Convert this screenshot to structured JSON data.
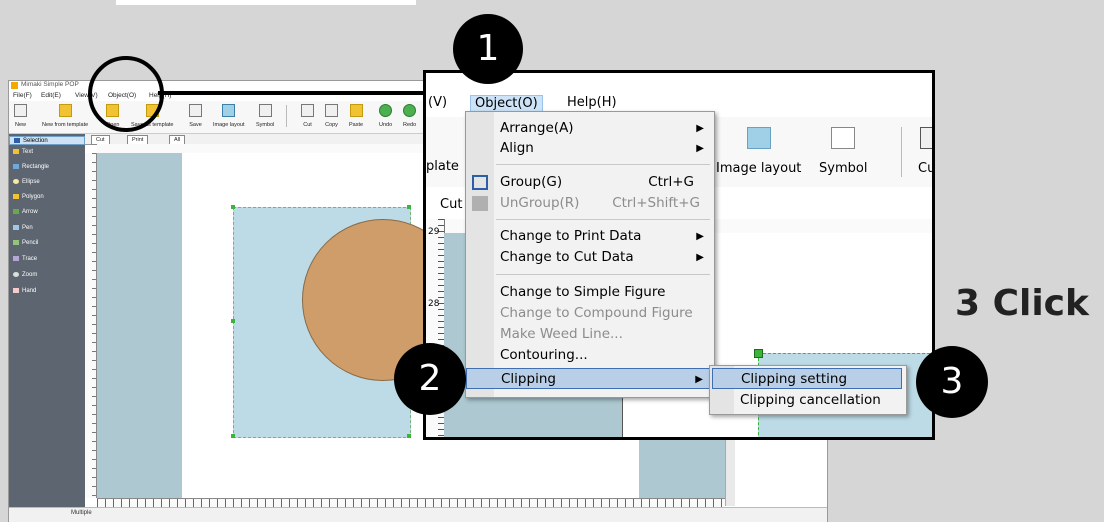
{
  "app": {
    "window_title": "Mimaki Simple POP",
    "menu": [
      "File(F)",
      "Edit(E)",
      "View(V)",
      "Object(O)",
      "Help(H)"
    ],
    "toolbar": [
      "New",
      "New from template",
      "Open",
      "Save as template",
      "Save",
      "Image layout",
      "Symbol",
      "Cut",
      "Copy",
      "Paste",
      "Undo",
      "Redo"
    ],
    "tools": [
      "Selection",
      "Text",
      "Rectangle",
      "Ellipse",
      "Polygon",
      "Arrow",
      "Pen",
      "Pencil",
      "Trace",
      "Zoom",
      "Hand"
    ],
    "tabs": [
      "Cut",
      "Print",
      "All"
    ],
    "status": "Multiple"
  },
  "zoom": {
    "menu_view": "(V)",
    "menu_object": "Object(O)",
    "menu_help": "Help(H)",
    "toolbar_template": "plate",
    "toolbar_image": "Image layout",
    "toolbar_symbol": "Symbol",
    "toolbar_cut": "Cu",
    "tab_cut": "Cut",
    "ruler_29": "29",
    "ruler_28": "28"
  },
  "object_menu": {
    "items": [
      {
        "label": "Arrange(A)",
        "shortcut": "",
        "submenu": true,
        "disabled": false
      },
      {
        "label": "Align",
        "shortcut": "",
        "submenu": true,
        "disabled": false
      },
      {
        "label": "Group(G)",
        "shortcut": "Ctrl+G",
        "submenu": false,
        "disabled": false
      },
      {
        "label": "UnGroup(R)",
        "shortcut": "Ctrl+Shift+G",
        "submenu": false,
        "disabled": true
      },
      {
        "label": "Change to Print Data",
        "shortcut": "",
        "submenu": true,
        "disabled": false
      },
      {
        "label": "Change to Cut Data",
        "shortcut": "",
        "submenu": true,
        "disabled": false
      },
      {
        "label": "Change to Simple Figure",
        "shortcut": "",
        "submenu": false,
        "disabled": false
      },
      {
        "label": "Change to Compound Figure",
        "shortcut": "",
        "submenu": false,
        "disabled": true
      },
      {
        "label": "Make Weed Line...",
        "shortcut": "",
        "submenu": false,
        "disabled": true
      },
      {
        "label": "Contouring...",
        "shortcut": "",
        "submenu": false,
        "disabled": false
      },
      {
        "label": "Clipping",
        "shortcut": "",
        "submenu": true,
        "disabled": false
      }
    ]
  },
  "clipping_submenu": [
    "Clipping setting",
    "Clipping cancellation"
  ],
  "annotations": {
    "step1": "1",
    "step2": "2",
    "step3": "3",
    "click_label": "3 Click"
  },
  "colors": {
    "highlight": "#b9cfe8",
    "badge": "#000000",
    "canvas_blue": "#adc8d1",
    "shape_fill": "#cf9d6a"
  }
}
